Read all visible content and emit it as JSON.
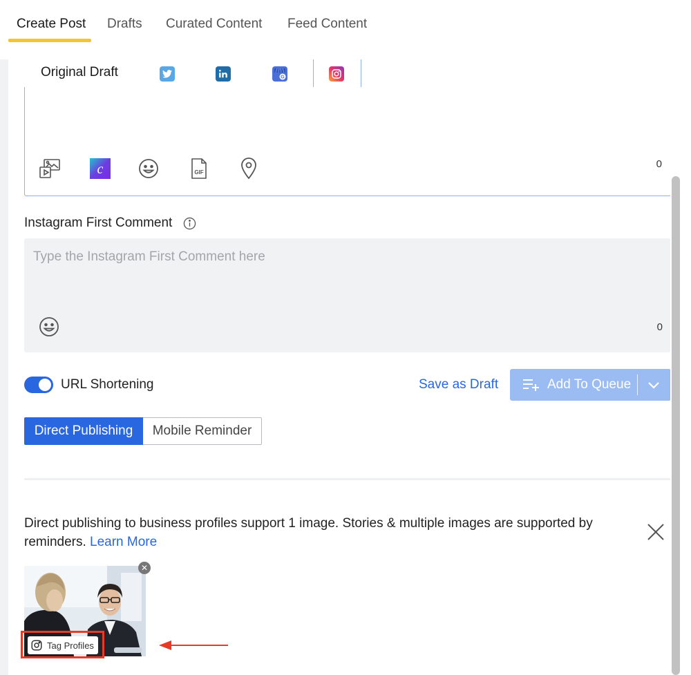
{
  "nav": {
    "tabs": [
      {
        "label": "Create Post",
        "active": true
      },
      {
        "label": "Drafts",
        "active": false
      },
      {
        "label": "Curated Content",
        "active": false
      },
      {
        "label": "Feed Content",
        "active": false
      }
    ]
  },
  "draft_tabs": {
    "original_label": "Original Draft",
    "networks": [
      "twitter-icon",
      "linkedin-icon",
      "google-my-business-icon",
      "instagram-icon"
    ],
    "active_network": "instagram-icon"
  },
  "editor": {
    "tools": [
      "media-icon",
      "canva-icon",
      "emoji-icon",
      "gif-icon",
      "location-icon"
    ],
    "char_count": "0"
  },
  "first_comment": {
    "label": "Instagram First Comment",
    "placeholder": "Type the Instagram First Comment here",
    "char_count": "0"
  },
  "url_shortening": {
    "label": "URL Shortening",
    "enabled": true
  },
  "actions": {
    "save_draft": "Save as Draft",
    "add_to_queue": "Add To Queue"
  },
  "publish_mode": {
    "direct": "Direct Publishing",
    "mobile": "Mobile Reminder",
    "selected": "direct"
  },
  "notice": {
    "text": "Direct publishing to business profiles support 1 image. Stories & multiple images are supported by reminders.",
    "link": "Learn More"
  },
  "media": {
    "remove_glyph": "✕",
    "tag_label": "Tag Profiles"
  },
  "colors": {
    "accent": "#2867e0",
    "tab_underline": "#f3c534",
    "highlight": "#e63b27"
  }
}
